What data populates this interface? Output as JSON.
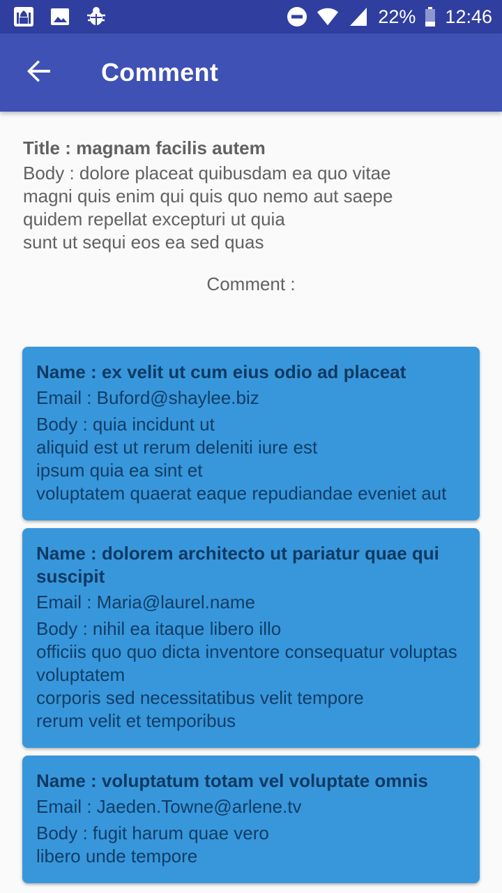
{
  "status_bar": {
    "battery": "22%",
    "time": "12:46",
    "icons": [
      "mosque-app-icon",
      "image-icon",
      "bug-icon",
      "do-not-disturb-icon",
      "wifi-icon",
      "signal-icon",
      "battery-icon"
    ]
  },
  "app_bar": {
    "title": "Comment",
    "back_icon": "arrow-back-icon"
  },
  "post": {
    "title": "Title : magnam facilis autem",
    "body": "Body  : dolore placeat quibusdam ea quo vitae\nmagni quis enim qui quis quo nemo aut saepe\nquidem repellat excepturi ut quia\nsunt ut sequi eos ea sed quas"
  },
  "comment_heading": "Comment :",
  "comments": [
    {
      "name": "Name : ex velit ut cum eius odio ad placeat",
      "email": "Email : Buford@shaylee.biz",
      "body": "Body : quia incidunt ut\naliquid est ut rerum deleniti iure est\nipsum quia ea sint et\nvoluptatem quaerat eaque repudiandae eveniet aut"
    },
    {
      "name": "Name : dolorem architecto ut pariatur quae qui suscipit",
      "email": "Email : Maria@laurel.name",
      "body": "Body : nihil ea itaque libero illo\nofficiis quo quo dicta inventore consequatur voluptas voluptatem\ncorporis sed necessitatibus velit tempore\nrerum velit et temporibus"
    },
    {
      "name": "Name : voluptatum totam vel voluptate omnis",
      "email": "Email : Jaeden.Towne@arlene.tv",
      "body": "Body : fugit harum quae vero\nlibero unde tempore"
    }
  ],
  "colors": {
    "status_bar": "#303f9f",
    "app_bar": "#3f51b5",
    "card": "#3897db",
    "card_text": "#0e3a63"
  }
}
